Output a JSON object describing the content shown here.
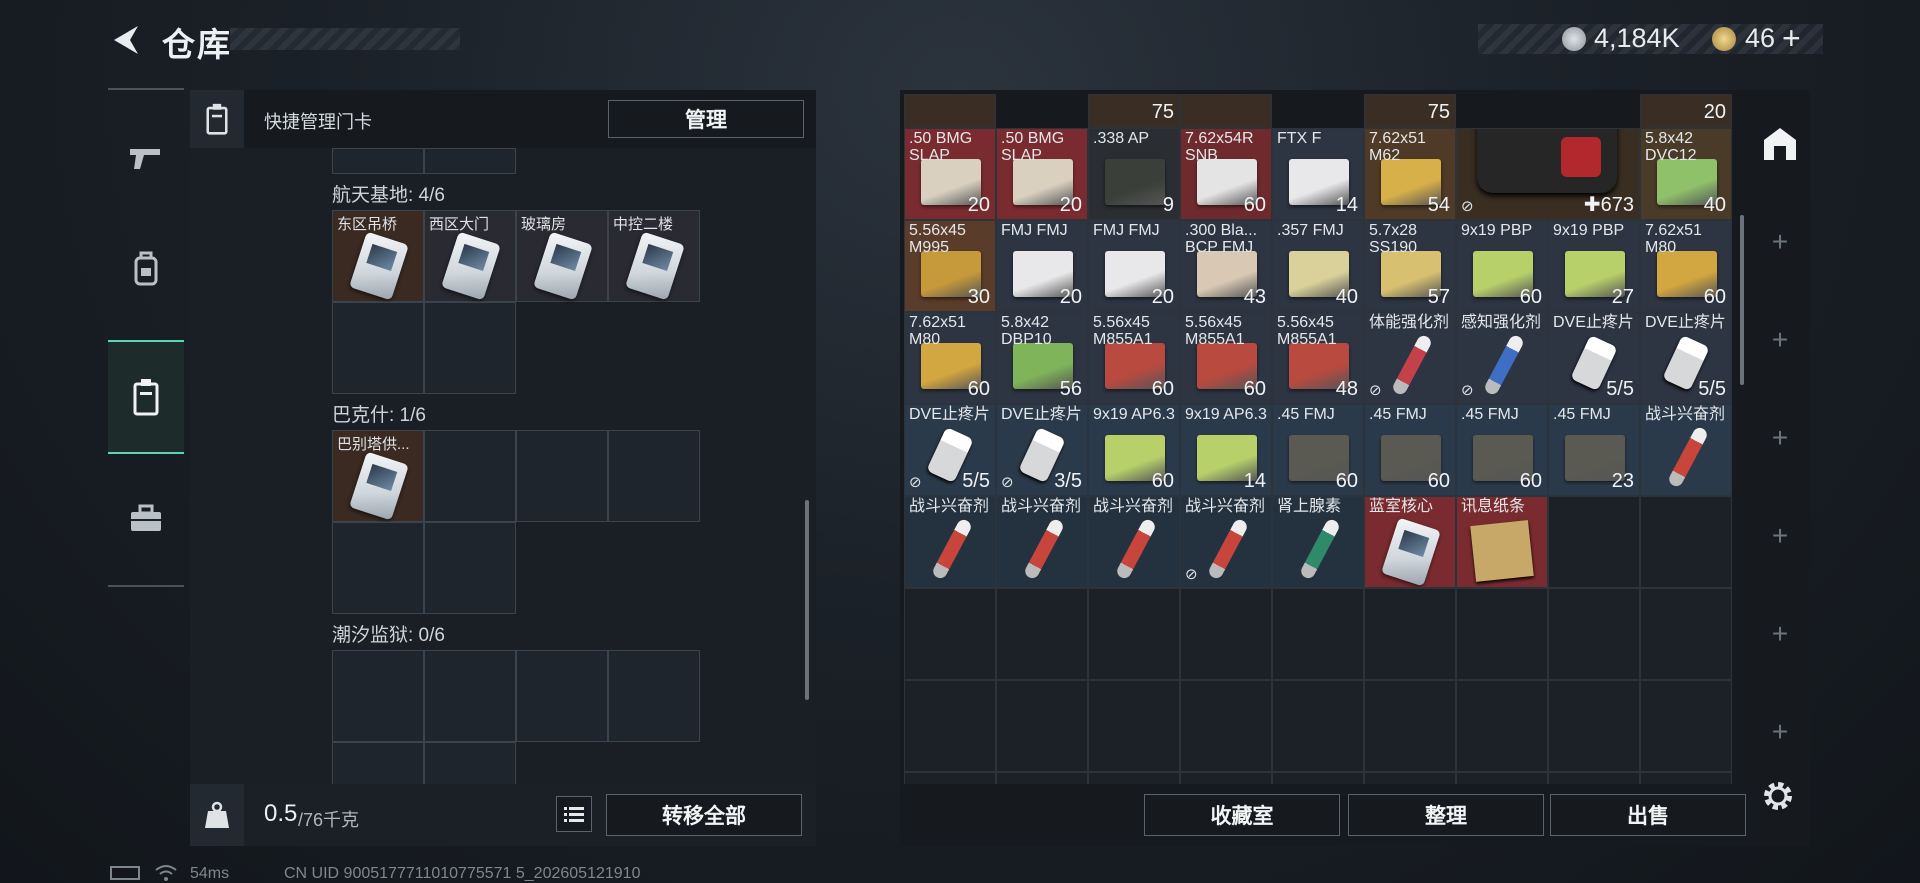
{
  "header": {
    "title": "仓库",
    "currency": [
      {
        "icon": "silver-coin-icon",
        "value": "4,184K",
        "color": "#b9c0c6"
      },
      {
        "icon": "gold-coin-icon",
        "value": "46",
        "color": "#c9a95a"
      }
    ],
    "add_label": "+"
  },
  "nav": [
    {
      "name": "pistol-icon",
      "active": false
    },
    {
      "name": "backpack-icon",
      "active": false
    },
    {
      "name": "keycard-holder-icon",
      "active": true
    },
    {
      "name": "toolbox-icon",
      "active": false
    }
  ],
  "left_panel": {
    "header_label": "快捷管理门卡",
    "manage_button": "管理",
    "sections": [
      {
        "title": "航天基地: 4/6",
        "cards": [
          "东区吊桥",
          "西区大门",
          "玻璃房",
          "中控二楼"
        ]
      },
      {
        "title": "巴克什: 1/6",
        "cards": [
          "巴别塔供..."
        ]
      },
      {
        "title": "潮汐监狱: 0/6",
        "cards": []
      }
    ],
    "weight": "0.5",
    "weight_unit": "/76千克",
    "transfer_all_button": "转移全部"
  },
  "grid_top_row": [
    {
      "col": 0,
      "text": ""
    },
    {
      "col": 2,
      "text": "75"
    },
    {
      "col": 3,
      "text": ""
    },
    {
      "col": 5,
      "text": "75"
    },
    {
      "col": 8,
      "text": "20"
    }
  ],
  "items": [
    {
      "row": 0,
      "col": 0,
      "name": ".50 BMG SLAP",
      "count": "20",
      "bg": "#7a2b2f",
      "art": "box",
      "art_color": "#d9d0c0"
    },
    {
      "row": 0,
      "col": 1,
      "name": ".50 BMG SLAP",
      "count": "20",
      "bg": "#7a2b2f",
      "art": "box",
      "art_color": "#d9d0c0"
    },
    {
      "row": 0,
      "col": 2,
      "name": ".338 AP",
      "count": "9",
      "bg": "#2a2d31",
      "art": "box",
      "art_color": "#3a3f3a"
    },
    {
      "row": 0,
      "col": 3,
      "name": "7.62x54R SNB",
      "count": "60",
      "bg": "#6e2a2c",
      "art": "box",
      "art_color": "#e4e4e4"
    },
    {
      "row": 0,
      "col": 4,
      "name": "FTX F",
      "count": "14",
      "bg": "#2d3442",
      "art": "box",
      "art_color": "#e8e8ea"
    },
    {
      "row": 0,
      "col": 5,
      "name": "7.62x51 M62",
      "count": "54",
      "bg": "#4e3a26",
      "art": "box",
      "art_color": "#d8b04a"
    },
    {
      "row": 0,
      "col": 6,
      "name": "",
      "count": "673",
      "bg": "#3a2e22",
      "art": "medkit",
      "art_color": "#2a2a2a",
      "lock": true,
      "plus": true
    },
    {
      "row": 0,
      "col": 8,
      "name": "5.8x42 DVC12",
      "count": "40",
      "bg": "#4a3a28",
      "art": "box",
      "art_color": "#8fc06a"
    },
    {
      "row": 1,
      "col": 0,
      "name": "5.56x45 M995",
      "count": "30",
      "bg": "#5a3c2a",
      "art": "box",
      "art_color": "#c69a3a"
    },
    {
      "row": 1,
      "col": 1,
      "name": "FMJ FMJ",
      "count": "20",
      "bg": "#2d3442",
      "art": "box",
      "art_color": "#e8e8ea"
    },
    {
      "row": 1,
      "col": 2,
      "name": "FMJ FMJ",
      "count": "20",
      "bg": "#2d3442",
      "art": "box",
      "art_color": "#e8e8ea"
    },
    {
      "row": 1,
      "col": 3,
      "name": ".300 Bla... BCP FMJ",
      "count": "43",
      "bg": "#2d3442",
      "art": "box",
      "art_color": "#d9c9b4"
    },
    {
      "row": 1,
      "col": 4,
      "name": ".357 FMJ",
      "count": "40",
      "bg": "#2d3442",
      "art": "box",
      "art_color": "#d9d09a"
    },
    {
      "row": 1,
      "col": 5,
      "name": "5.7x28 SS190",
      "count": "57",
      "bg": "#2d3442",
      "art": "box",
      "art_color": "#d7c070"
    },
    {
      "row": 1,
      "col": 6,
      "name": "9x19 PBP",
      "count": "60",
      "bg": "#2d3442",
      "art": "box",
      "art_color": "#b7d06a"
    },
    {
      "row": 1,
      "col": 7,
      "name": "9x19 PBP",
      "count": "27",
      "bg": "#2d3442",
      "art": "box",
      "art_color": "#b7d06a"
    },
    {
      "row": 1,
      "col": 8,
      "name": "7.62x51 M80",
      "count": "60",
      "bg": "#2d3442",
      "art": "box",
      "art_color": "#d2a640"
    },
    {
      "row": 2,
      "col": 0,
      "name": "7.62x51 M80",
      "count": "60",
      "bg": "#2d3442",
      "art": "box",
      "art_color": "#d2a640"
    },
    {
      "row": 2,
      "col": 1,
      "name": "5.8x42 DBP10",
      "count": "56",
      "bg": "#2d3442",
      "art": "box",
      "art_color": "#7fb45a"
    },
    {
      "row": 2,
      "col": 2,
      "name": "5.56x45 M855A1",
      "count": "60",
      "bg": "#2d3442",
      "art": "box",
      "art_color": "#b84a40"
    },
    {
      "row": 2,
      "col": 3,
      "name": "5.56x45 M855A1",
      "count": "60",
      "bg": "#2d3442",
      "art": "box",
      "art_color": "#b84a40"
    },
    {
      "row": 2,
      "col": 4,
      "name": "5.56x45 M855A1",
      "count": "48",
      "bg": "#2d3442",
      "art": "box",
      "art_color": "#b84a40"
    },
    {
      "row": 2,
      "col": 5,
      "name": "体能强化剂",
      "count": "",
      "bg": "#2d3442",
      "art": "vial",
      "art_color": "#c4404a",
      "lock": true
    },
    {
      "row": 2,
      "col": 6,
      "name": "感知强化剂",
      "count": "",
      "bg": "#2d3442",
      "art": "vial",
      "art_color": "#3e6fc4",
      "lock": true
    },
    {
      "row": 2,
      "col": 7,
      "name": "DVE止疼片",
      "count": "5/5",
      "bg": "#2d3442",
      "art": "pill",
      "art_color": "#d6d8da"
    },
    {
      "row": 2,
      "col": 8,
      "name": "DVE止疼片",
      "count": "5/5",
      "bg": "#2d3442",
      "art": "pill",
      "art_color": "#d6d8da"
    },
    {
      "row": 3,
      "col": 0,
      "name": "DVE止疼片",
      "count": "5/5",
      "bg": "#2b3a4a",
      "art": "pill",
      "art_color": "#d6d8da",
      "lock": true
    },
    {
      "row": 3,
      "col": 1,
      "name": "DVE止疼片",
      "count": "3/5",
      "bg": "#2b3a4a",
      "art": "pill",
      "art_color": "#d6d8da",
      "lock": true
    },
    {
      "row": 3,
      "col": 2,
      "name": "9x19 AP6.3",
      "count": "60",
      "bg": "#2b3a4a",
      "art": "box",
      "art_color": "#b7d06a"
    },
    {
      "row": 3,
      "col": 3,
      "name": "9x19 AP6.3",
      "count": "14",
      "bg": "#2b3a4a",
      "art": "box",
      "art_color": "#b7d06a"
    },
    {
      "row": 3,
      "col": 4,
      "name": ".45 FMJ",
      "count": "60",
      "bg": "#2b3a4a",
      "art": "box",
      "art_color": "#5a5a52"
    },
    {
      "row": 3,
      "col": 5,
      "name": ".45 FMJ",
      "count": "60",
      "bg": "#2b3a4a",
      "art": "box",
      "art_color": "#5a5a52"
    },
    {
      "row": 3,
      "col": 6,
      "name": ".45 FMJ",
      "count": "60",
      "bg": "#2b3a4a",
      "art": "box",
      "art_color": "#5a5a52"
    },
    {
      "row": 3,
      "col": 7,
      "name": ".45 FMJ",
      "count": "23",
      "bg": "#2b3a4a",
      "art": "box",
      "art_color": "#5a5a52"
    },
    {
      "row": 3,
      "col": 8,
      "name": "战斗兴奋剂",
      "count": "",
      "bg": "#2b3a4a",
      "art": "vial",
      "art_color": "#c8453c"
    },
    {
      "row": 4,
      "col": 0,
      "name": "战斗兴奋剂",
      "count": "",
      "bg": "#243240",
      "art": "vial",
      "art_color": "#c8453c"
    },
    {
      "row": 4,
      "col": 1,
      "name": "战斗兴奋剂",
      "count": "",
      "bg": "#243240",
      "art": "vial",
      "art_color": "#c8453c"
    },
    {
      "row": 4,
      "col": 2,
      "name": "战斗兴奋剂",
      "count": "",
      "bg": "#243240",
      "art": "vial",
      "art_color": "#c8453c"
    },
    {
      "row": 4,
      "col": 3,
      "name": "战斗兴奋剂",
      "count": "",
      "bg": "#243240",
      "art": "vial",
      "art_color": "#c8453c",
      "lock": true
    },
    {
      "row": 4,
      "col": 4,
      "name": "肾上腺素",
      "count": "",
      "bg": "#243240",
      "art": "vial",
      "art_color": "#2f8a6a"
    },
    {
      "row": 4,
      "col": 5,
      "name": "蓝室核心",
      "count": "",
      "bg": "#7a2b2f",
      "art": "card",
      "art_color": "#e6eaee"
    },
    {
      "row": 4,
      "col": 6,
      "name": "讯息纸条",
      "count": "",
      "bg": "#7a2b2f",
      "art": "paper",
      "art_color": "#c8a868"
    }
  ],
  "right_footer": {
    "buttons": [
      "收藏室",
      "整理",
      "出售"
    ]
  },
  "status_bar": {
    "ping": "54ms",
    "uid": "CN UID 9005177711010775571 5_202605121910"
  }
}
